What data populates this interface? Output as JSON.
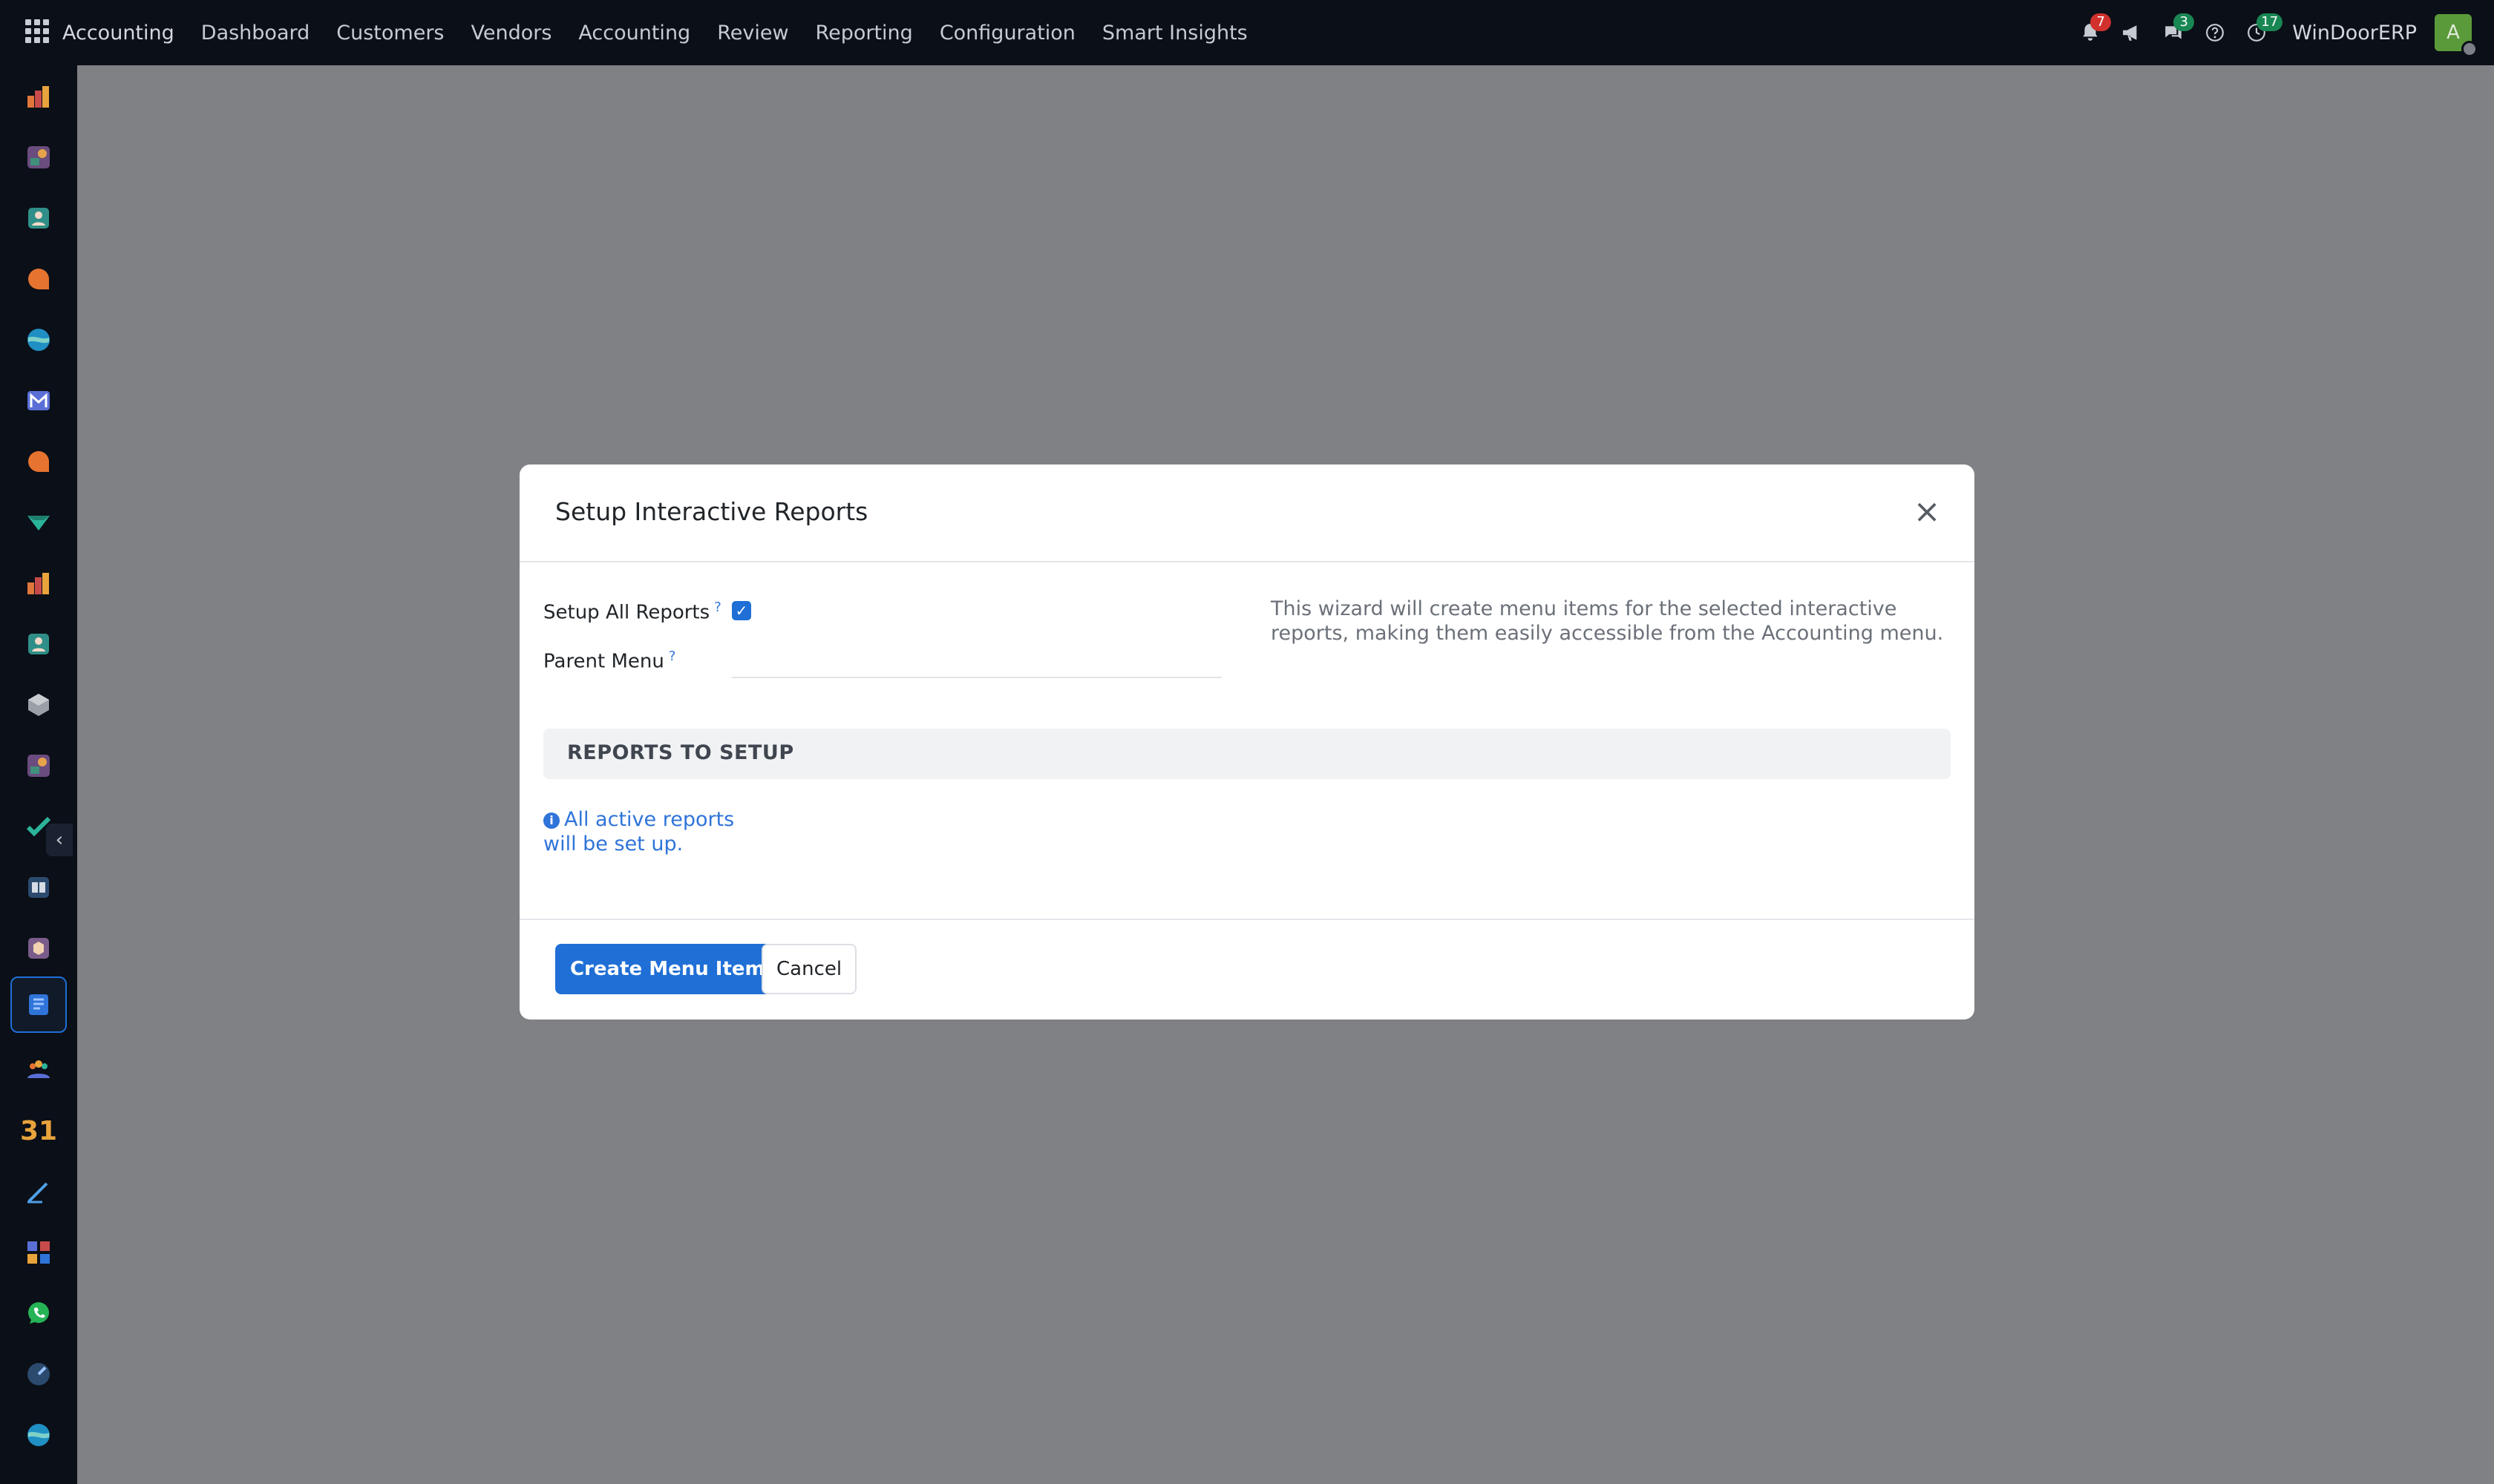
{
  "topbar": {
    "brand": "Accounting",
    "nav": [
      "Dashboard",
      "Customers",
      "Vendors",
      "Accounting",
      "Review",
      "Reporting",
      "Configuration",
      "Smart Insights"
    ],
    "notifications_count": "7",
    "messages_count": "3",
    "activities_count": "17",
    "company": "WinDoorERP",
    "avatar_initial": "A"
  },
  "sidebar": {
    "icons": [
      "accounting-app-icon",
      "app-icon",
      "contacts-app-icon",
      "discuss-app-icon",
      "app-icon",
      "email-marketing-app-icon",
      "discuss-app-icon",
      "app-icon",
      "accounting-app-icon",
      "contacts-app-icon",
      "inventory-app-icon",
      "app-icon",
      "project-app-icon",
      "knowledge-app-icon",
      "app-icon",
      "documents-app-icon",
      "employees-app-icon",
      "calendar-app-icon",
      "sign-app-icon",
      "dashboards-app-icon",
      "whatsapp-app-icon",
      "app-icon",
      "app-icon"
    ],
    "calendar_label": "31"
  },
  "modal": {
    "title": "Setup Interactive Reports",
    "setup_all_label": "Setup All Reports",
    "parent_menu_label": "Parent Menu",
    "help_marker": "?",
    "parent_menu_value": "",
    "help_text": "This wizard will create menu items for the selected interactive reports, making them easily accessible from the Accounting menu.",
    "section_title": "REPORTS TO SETUP",
    "info_note": "All active reports will be set up.",
    "primary_button": "Create Menu Items",
    "cancel_button": "Cancel"
  },
  "colors": {
    "primary": "#1f6fd6",
    "topbar_bg": "#0b0f17",
    "overlay_bg": "#808184"
  }
}
